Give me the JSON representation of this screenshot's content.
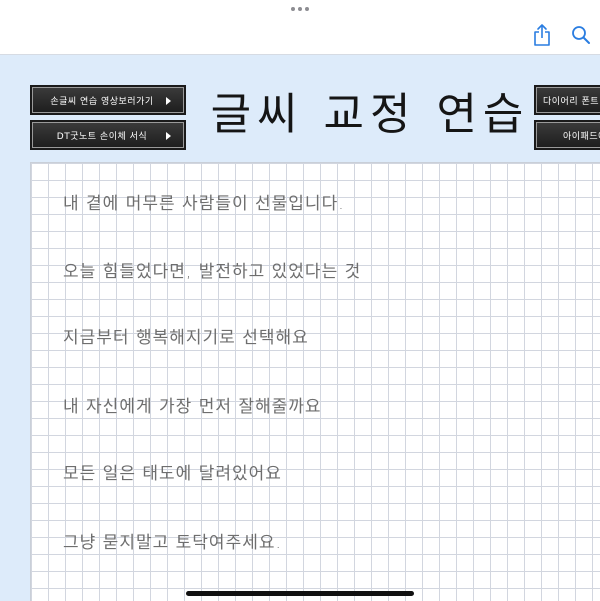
{
  "toolbar": {
    "share_icon": "share-icon",
    "search_icon": "search-icon"
  },
  "buttons": {
    "video": "손글씨 연습 영상보러가기",
    "goodnote": "DT굿노트 손이체 서식",
    "diary": "다이어리 폰트",
    "ipad": "아이패드에"
  },
  "title": "글씨 교정 연습",
  "practice_lines": [
    "내 곁에 머무른 사람들이 선물입니다.",
    "오늘 힘들었다면, 발전하고 있었다는 것",
    "지금부터 행복해지기로 선택해요",
    "내 자신에게 가장 먼저 잘해줄까요",
    "모든 일은 태도에 달려있어요",
    "그냥 묻지말고 토닥여주세요."
  ],
  "colors": {
    "background": "#ddebfa",
    "accent": "#1a73e8",
    "button": "#2a2a2a"
  }
}
